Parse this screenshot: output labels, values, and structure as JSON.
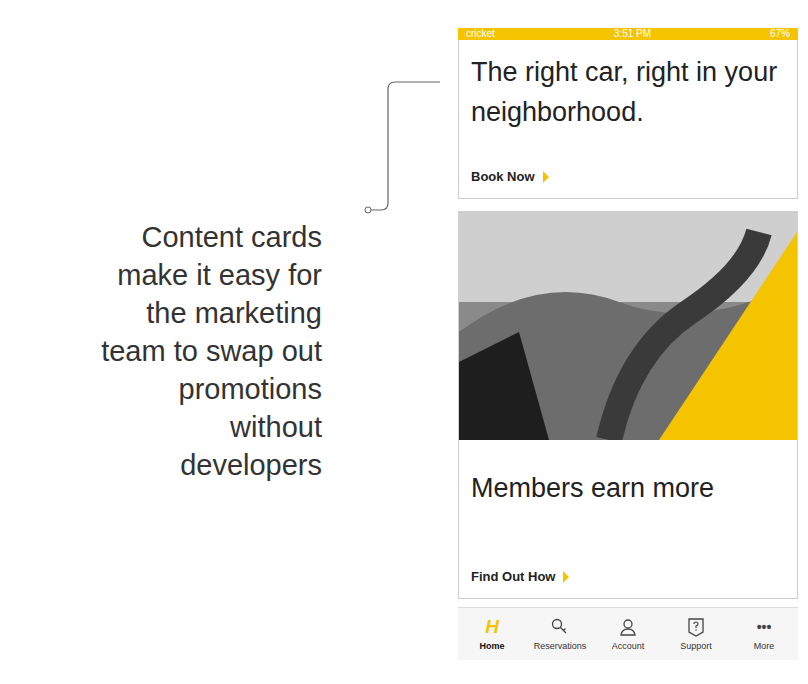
{
  "caption": "Content cards make it easy for the marketing team to swap out promotions without developers",
  "status_bar": {
    "carrier": "cricket",
    "time": "3:51 PM",
    "battery": "67%"
  },
  "cards": [
    {
      "kind": "text",
      "title": "The right car, right in your neighborhood.",
      "link": "Book Now"
    },
    {
      "kind": "image",
      "title": "Members earn more",
      "link": "Find Out How"
    }
  ],
  "nav": [
    {
      "label": "Home",
      "kind": "glyph",
      "glyph": "H",
      "selected": true
    },
    {
      "label": "Reservations",
      "kind": "key",
      "selected": false
    },
    {
      "label": "Account",
      "kind": "person",
      "selected": false
    },
    {
      "label": "Support",
      "kind": "help",
      "selected": false
    },
    {
      "label": "More",
      "kind": "glyph",
      "glyph": "•••",
      "selected": false
    }
  ]
}
